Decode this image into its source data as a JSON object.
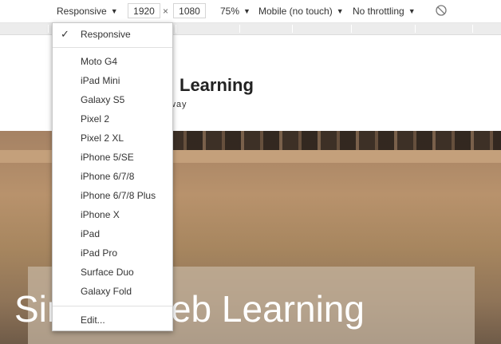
{
  "toolbar": {
    "device_label": "Responsive",
    "width_value": "1920",
    "times": "×",
    "height_value": "1080",
    "zoom_label": "75%",
    "touch_label": "Mobile (no touch)",
    "throttle_label": "No throttling",
    "caret": "▼"
  },
  "page": {
    "site_title": "Learning",
    "site_tagline": "way",
    "hero_title": "Simple Web Learning"
  },
  "dropdown": {
    "check": "✓",
    "selected": "Responsive",
    "devices": [
      "Moto G4",
      "iPad Mini",
      "Galaxy S5",
      "Pixel 2",
      "Pixel 2 XL",
      "iPhone 5/SE",
      "iPhone 6/7/8",
      "iPhone 6/7/8 Plus",
      "iPhone X",
      "iPad",
      "iPad Pro",
      "Surface Duo",
      "Galaxy Fold"
    ],
    "edit_label": "Edit..."
  }
}
